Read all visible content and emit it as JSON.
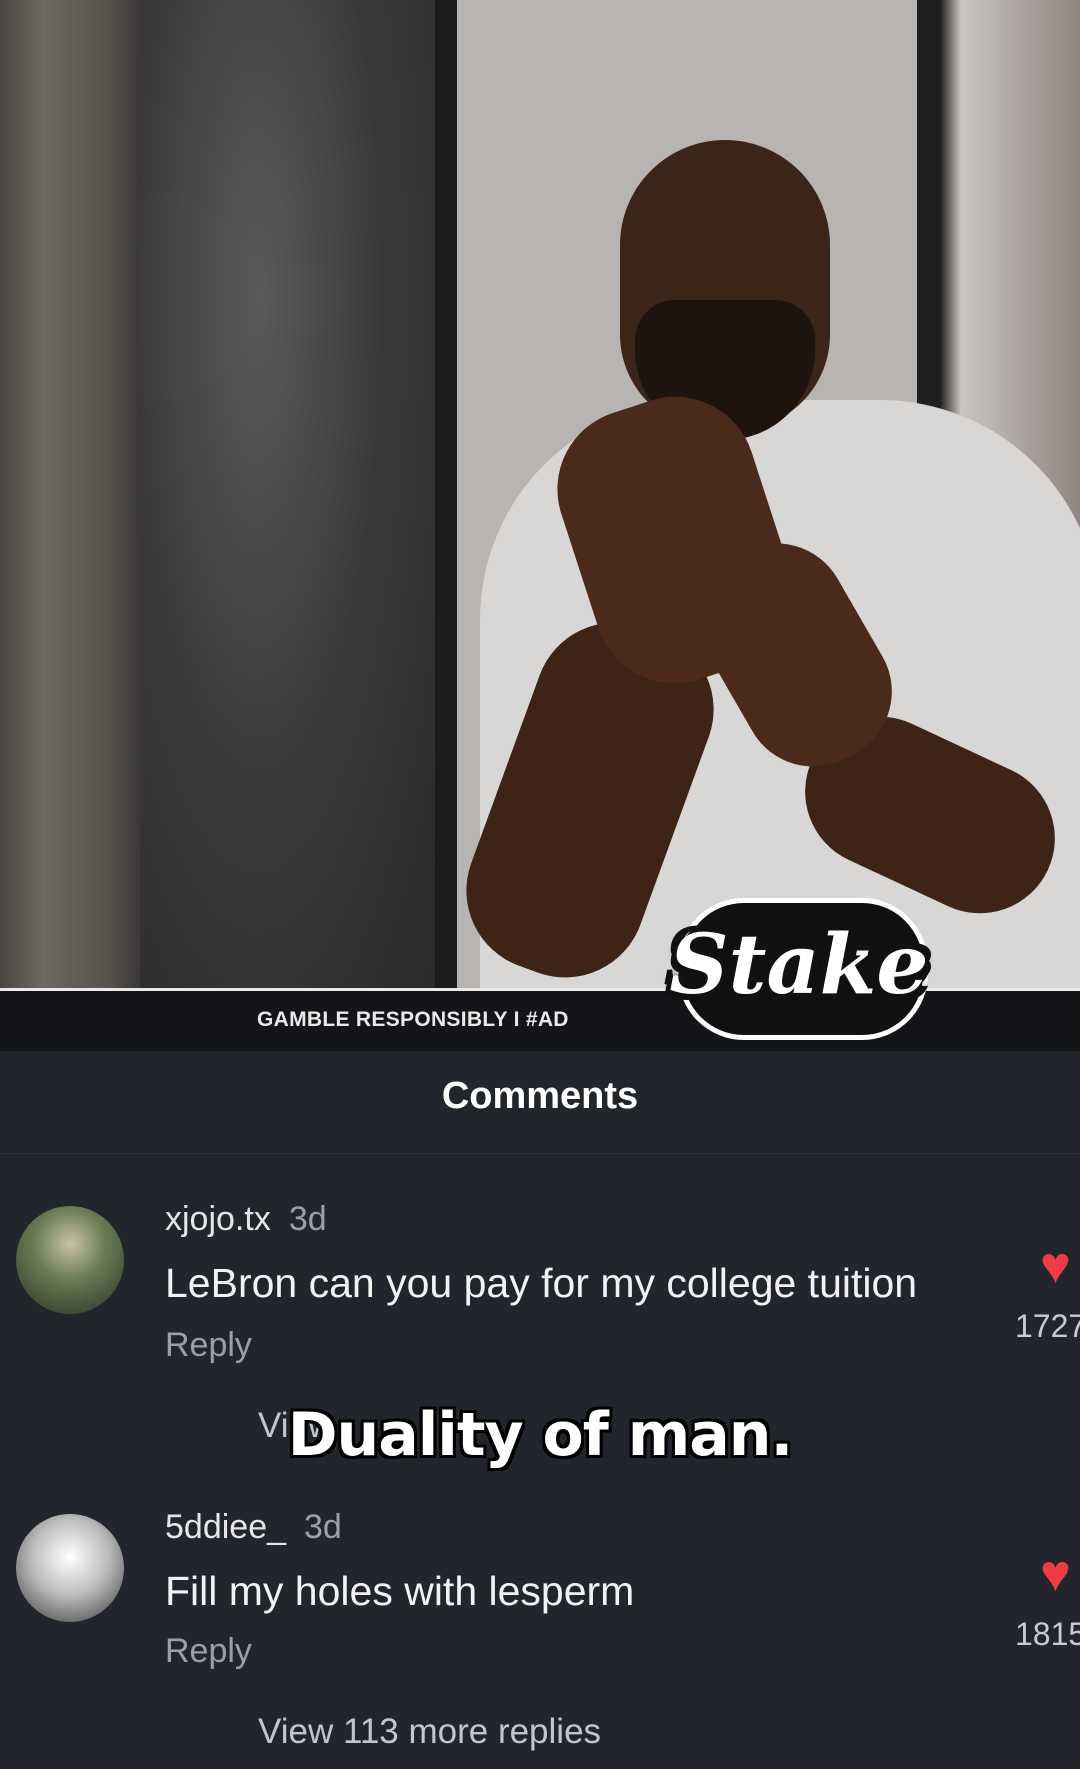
{
  "ad_banner": {
    "text": "GAMBLE RESPONSIBLY  I  #AD",
    "brand_logo": "Stake"
  },
  "comments_panel": {
    "title": "Comments",
    "items": [
      {
        "username": "xjojo.tx",
        "time": "3d",
        "text": "LeBron can you pay for my college tuition",
        "reply_label": "Reply",
        "likes": "1727",
        "view_replies": "View"
      },
      {
        "username": "5ddiee_",
        "time": "3d",
        "text": "Fill my holes with lesperm",
        "reply_label": "Reply",
        "likes": "1815",
        "view_replies": "View 113 more replies"
      }
    ]
  },
  "caption": "Duality of man.",
  "colors": {
    "background": "#22252c",
    "heart": "#ef3b43"
  }
}
